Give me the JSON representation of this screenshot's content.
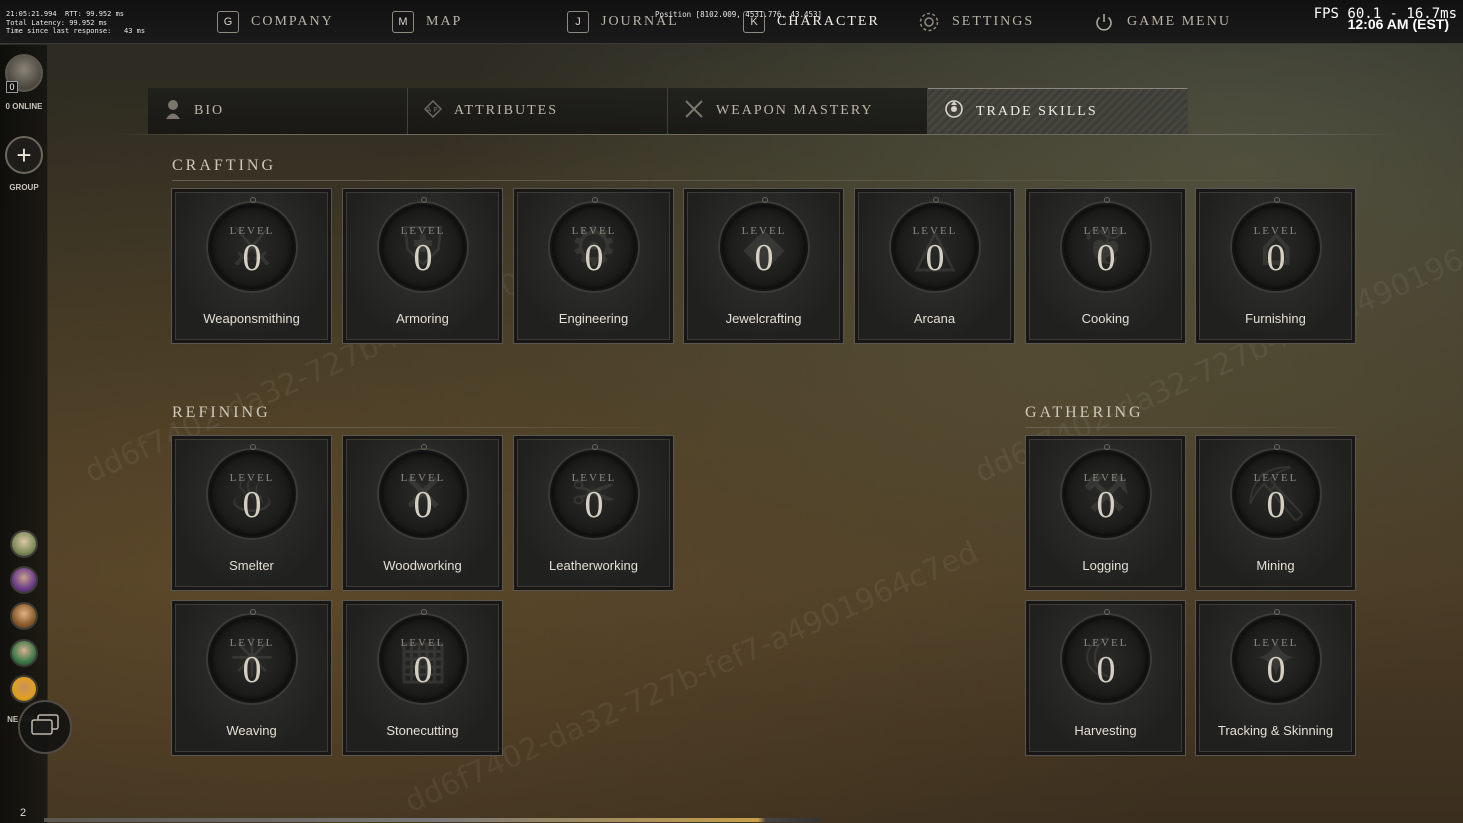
{
  "debug": {
    "lines": [
      "21:05:21.994  RTT: 99.952 ms",
      "Total Latency: 99.952 ms",
      "Time since last response:   43 ms"
    ],
    "position": "Position [8102.009, 4531.776, 43.453]",
    "fps": "FPS 60.1 - 16.7ms"
  },
  "clock": "12:06 AM (EST)",
  "topnav": [
    {
      "key": "G",
      "label": "COMPANY"
    },
    {
      "key": "M",
      "label": "MAP"
    },
    {
      "key": "J",
      "label": "JOURNAL"
    },
    {
      "key": "K",
      "label": "CHARACTER"
    },
    {
      "icon": "gear-icon",
      "label": "SETTINGS"
    },
    {
      "icon": "power-icon",
      "label": "GAME MENU"
    }
  ],
  "rail": {
    "online_count": "0",
    "online_label": "0 ONLINE",
    "group_label": "GROUP",
    "nearby_label": "NEARBY",
    "chat_count": "2"
  },
  "tabs": [
    {
      "label": "BIO",
      "icon": "person-icon"
    },
    {
      "label": "ATTRIBUTES",
      "icon": "attributes-icon"
    },
    {
      "label": "WEAPON MASTERY",
      "icon": "crossed-swords-icon"
    },
    {
      "label": "TRADE SKILLS",
      "icon": "trade-skills-icon",
      "active": true
    }
  ],
  "level_word": "LEVEL",
  "sections": {
    "crafting": {
      "title": "CRAFTING",
      "skills": [
        {
          "name": "Weaponsmithing",
          "level": "0"
        },
        {
          "name": "Armoring",
          "level": "0"
        },
        {
          "name": "Engineering",
          "level": "0"
        },
        {
          "name": "Jewelcrafting",
          "level": "0"
        },
        {
          "name": "Arcana",
          "level": "0"
        },
        {
          "name": "Cooking",
          "level": "0"
        },
        {
          "name": "Furnishing",
          "level": "0"
        }
      ]
    },
    "refining": {
      "title": "REFINING",
      "skills": [
        {
          "name": "Smelter",
          "level": "0"
        },
        {
          "name": "Woodworking",
          "level": "0"
        },
        {
          "name": "Leatherworking",
          "level": "0"
        },
        {
          "name": "Weaving",
          "level": "0"
        },
        {
          "name": "Stonecutting",
          "level": "0"
        }
      ]
    },
    "gathering": {
      "title": "GATHERING",
      "skills": [
        {
          "name": "Logging",
          "level": "0"
        },
        {
          "name": "Mining",
          "level": "0"
        },
        {
          "name": "Harvesting",
          "level": "0"
        },
        {
          "name": "Tracking & Skinning",
          "level": "0"
        }
      ]
    }
  },
  "watermark": "dd6f7402-da32-727b-fef7-a4901964c7ed"
}
